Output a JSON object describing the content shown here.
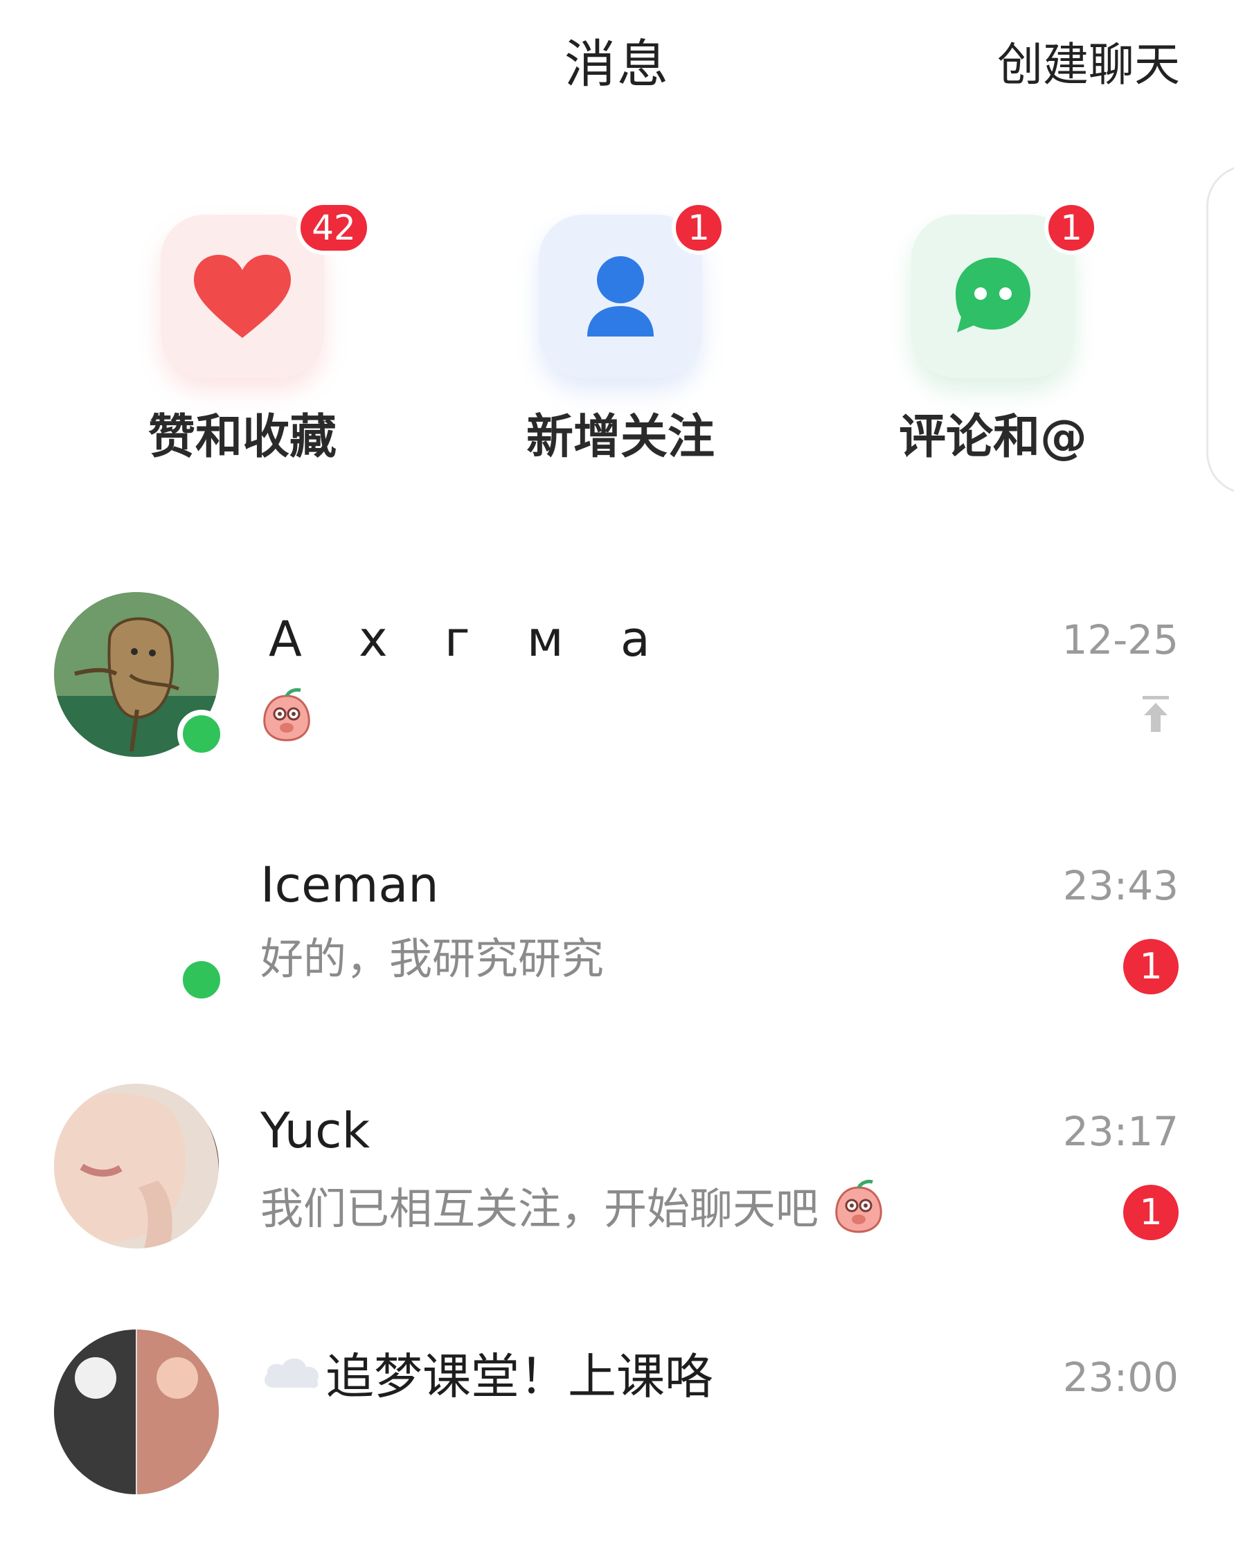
{
  "header": {
    "title": "消息",
    "create_chat_label": "创建聊天"
  },
  "quick_entries": [
    {
      "label": "赞和收藏",
      "badge": "42",
      "icon": "heart-icon",
      "color": "#f04a4a"
    },
    {
      "label": "新增关注",
      "badge": "1",
      "icon": "person-icon",
      "color": "#2f7be5"
    },
    {
      "label": "评论和@",
      "badge": "1",
      "icon": "chat-bubble-icon",
      "color": "#2ebf67"
    }
  ],
  "conversations": [
    {
      "name": "A x г м a",
      "time": "12-25",
      "preview": "",
      "preview_emoji": "peach-emoji",
      "pinned": true,
      "online": true,
      "unread": ""
    },
    {
      "name": "Iceman",
      "time": "23:43",
      "preview": "好的，我研究研究",
      "online": true,
      "unread": "1"
    },
    {
      "name": "Yuck",
      "time": "23:17",
      "preview": "我们已相互关注，开始聊天吧",
      "preview_emoji": "peach-emoji",
      "online": false,
      "unread": "1"
    },
    {
      "name": "追梦课堂！上课咯",
      "time": "23:00",
      "preview": "",
      "name_icon": "cloud-icon",
      "online": false,
      "unread": ""
    }
  ],
  "colors": {
    "badge": "#ee2a3b",
    "online": "#2fc35a",
    "muted_text": "#8b8b8b"
  }
}
